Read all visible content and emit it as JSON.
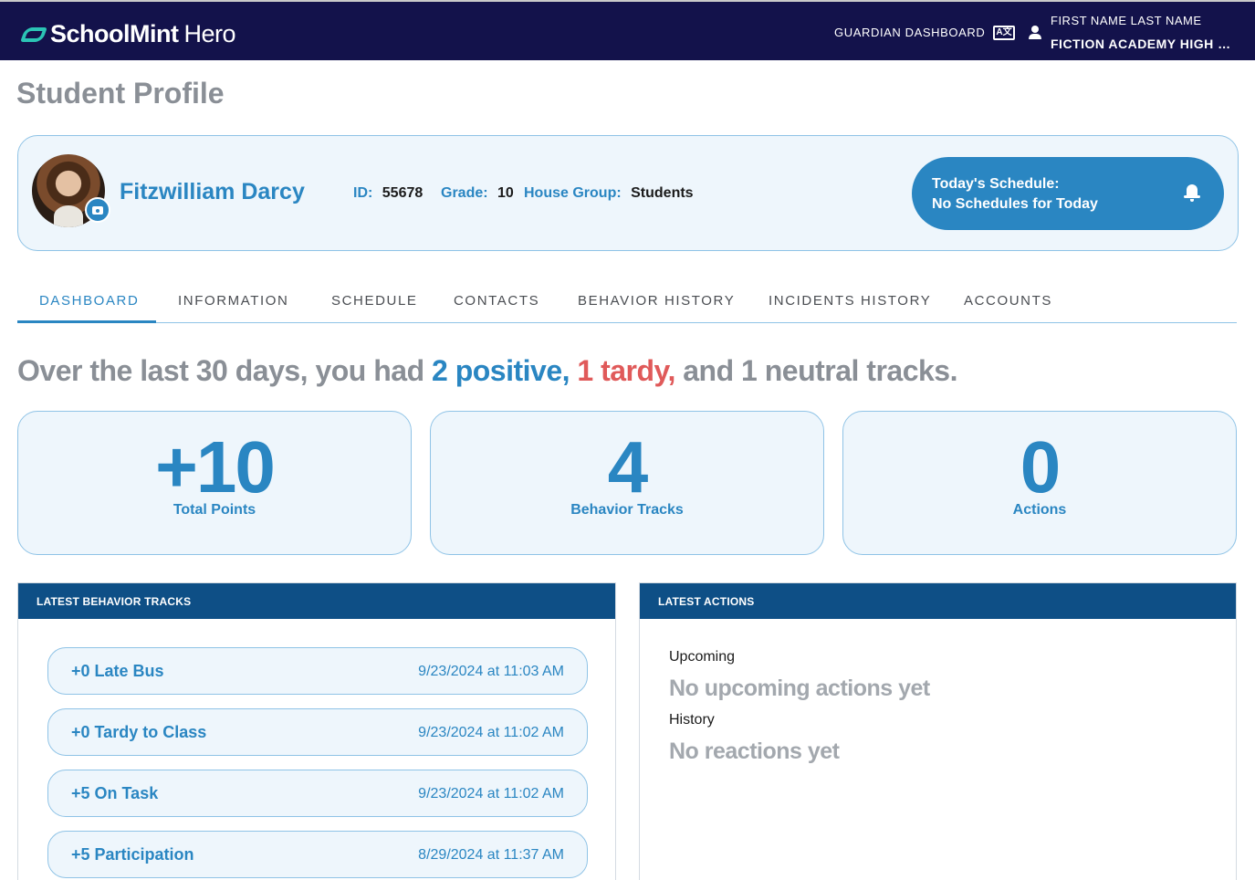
{
  "app": {
    "brand_bold": "SchoolMint",
    "brand_light": "Hero",
    "nav_link": "GUARDIAN DASHBOARD",
    "lang_icon_text": "A文",
    "user_name": "FIRST NAME LAST NAME",
    "user_school": "FICTION ACADEMY HIGH S..."
  },
  "page_title": "Student Profile",
  "student": {
    "name": "Fitzwilliam Darcy",
    "id_label": "ID:",
    "id": "55678",
    "grade_label": "Grade:",
    "grade": "10",
    "house_label": "House Group:",
    "house": "Students"
  },
  "schedule": {
    "title": "Today's Schedule:",
    "status": "No Schedules for Today"
  },
  "tabs": [
    {
      "label": "DASHBOARD",
      "active": true
    },
    {
      "label": "INFORMATION"
    },
    {
      "label": "SCHEDULE"
    },
    {
      "label": "CONTACTS"
    },
    {
      "label": "BEHAVIOR HISTORY"
    },
    {
      "label": "INCIDENTS HISTORY"
    },
    {
      "label": "ACCOUNTS"
    }
  ],
  "summary": {
    "prefix": "Over the last 30 days, you had ",
    "positive": "2 positive,",
    "tardy": " 1 tardy,",
    "suffix": " and 1 neutral tracks."
  },
  "stats": [
    {
      "value": "+10",
      "label": "Total Points"
    },
    {
      "value": "4",
      "label": "Behavior Tracks"
    },
    {
      "value": "0",
      "label": "Actions"
    }
  ],
  "behavior_panel": {
    "title": "LATEST BEHAVIOR TRACKS",
    "tracks": [
      {
        "name": "+0 Late Bus",
        "date": "9/23/2024 at 11:03 AM"
      },
      {
        "name": "+0 Tardy to Class",
        "date": "9/23/2024 at 11:02 AM"
      },
      {
        "name": "+5 On Task",
        "date": "9/23/2024 at 11:02 AM"
      },
      {
        "name": "+5 Participation",
        "date": "8/29/2024 at 11:37 AM"
      }
    ]
  },
  "actions_panel": {
    "title": "LATEST ACTIONS",
    "upcoming_label": "Upcoming",
    "upcoming_empty": "No upcoming actions yet",
    "history_label": "History",
    "history_empty": "No reactions yet"
  },
  "colors": {
    "navbar": "#13124b",
    "accent": "#2a86c2",
    "panel_header": "#0e4f86",
    "tardy": "#e05a5a",
    "muted": "#8a8f96"
  }
}
